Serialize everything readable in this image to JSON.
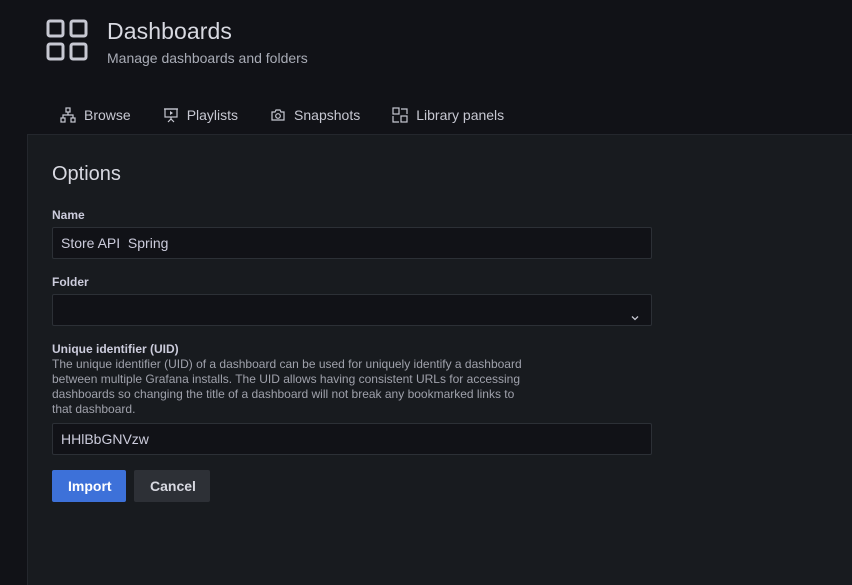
{
  "header": {
    "title": "Dashboards",
    "subtitle": "Manage dashboards and folders",
    "icon": "apps-grid-icon"
  },
  "tabs": [
    {
      "label": "Browse",
      "icon": "sitemap-icon"
    },
    {
      "label": "Playlists",
      "icon": "presentation-play-icon"
    },
    {
      "label": "Snapshots",
      "icon": "camera-icon"
    },
    {
      "label": "Library panels",
      "icon": "library-panel-icon"
    }
  ],
  "options": {
    "title": "Options",
    "name_label": "Name",
    "name_value": "Store API  Spring",
    "folder_label": "Folder",
    "folder_value": "",
    "uid_label": "Unique identifier (UID)",
    "uid_description": "The unique identifier (UID) of a dashboard can be used for uniquely identify a dashboard between multiple Grafana installs. The UID allows having consistent URLs for accessing dashboards so changing the title of a dashboard will not break any bookmarked links to that dashboard.",
    "uid_value": "HHlBbGNVzw"
  },
  "buttons": {
    "import": "Import",
    "cancel": "Cancel"
  },
  "colors": {
    "background": "#111217",
    "panel": "#181b1f",
    "primary": "#3d71d9",
    "secondary": "#2d3036"
  }
}
